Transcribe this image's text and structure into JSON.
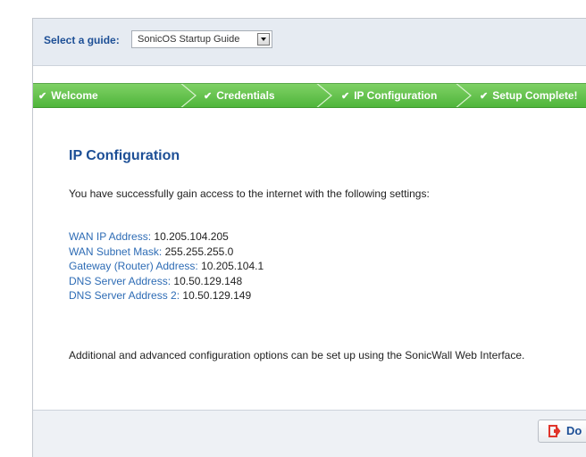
{
  "guide": {
    "label": "Select a guide:",
    "selected": "SonicOS Startup Guide"
  },
  "steps": [
    {
      "label": "Welcome"
    },
    {
      "label": "Credentials"
    },
    {
      "label": "IP Configuration"
    },
    {
      "label": "Setup Complete!"
    }
  ],
  "content": {
    "title": "IP Configuration",
    "intro": "You have successfully gain access to the internet with the following settings:",
    "settings": [
      {
        "label": "WAN IP Address:",
        "value": "10.205.104.205"
      },
      {
        "label": "WAN Subnet Mask:",
        "value": "255.255.255.0"
      },
      {
        "label": "Gateway (Router) Address:",
        "value": "10.205.104.1"
      },
      {
        "label": "DNS Server Address:",
        "value": "10.50.129.148"
      },
      {
        "label": "DNS Server Address 2:",
        "value": "10.50.129.149"
      }
    ],
    "footer": "Additional and advanced configuration options can be set up using the SonicWall Web Interface."
  },
  "footer_bar": {
    "done_label": "Do"
  },
  "colors": {
    "accent_blue": "#1d4f96",
    "link_blue": "#2e6cb5",
    "step_green": "#4fb53b",
    "done_icon_red": "#e0352b"
  },
  "icons": {
    "check": "check-icon",
    "step_separator": "chevron-right-icon",
    "done": "exit-icon"
  }
}
